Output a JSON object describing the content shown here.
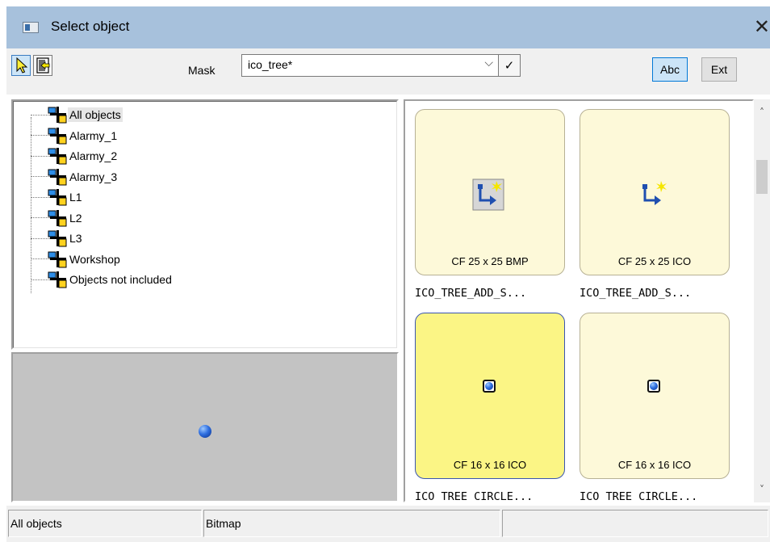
{
  "window": {
    "title": "Select object",
    "close_glyph": "✕"
  },
  "toolbar": {
    "mask_label": "Mask",
    "mask_value": "ico_tree*",
    "dropdown_glyph": "⌵",
    "apply_glyph": "✓",
    "abc_label": "Abc",
    "ext_label": "Ext",
    "pointer_icon": "select-pointer-icon",
    "exit_icon": "exit-icon"
  },
  "tree": {
    "items": [
      {
        "label": "All objects",
        "selected": true
      },
      {
        "label": "Alarmy_1"
      },
      {
        "label": "Alarmy_2"
      },
      {
        "label": "Alarmy_3"
      },
      {
        "label": "L1"
      },
      {
        "label": "L2"
      },
      {
        "label": "L3"
      },
      {
        "label": "Workshop"
      },
      {
        "label": "Objects not included"
      }
    ]
  },
  "gallery": {
    "items": [
      {
        "meta": "CF 25 x  25  BMP",
        "name": "ICO_TREE_ADD_S...",
        "icon": "tree-add-icon"
      },
      {
        "meta": "CF 25 x  25  ICO",
        "name": "ICO_TREE_ADD_S...",
        "icon": "tree-add-icon"
      },
      {
        "meta": "CF 16 x  16  ICO",
        "name": "ICO_TREE_CIRCLE...",
        "icon": "blue-circle-icon",
        "selected": true
      },
      {
        "meta": "CF 16 x  16  ICO",
        "name": "ICO_TREE_CIRCLE...",
        "icon": "blue-circle-icon"
      }
    ]
  },
  "statusbar": {
    "field1": "All objects",
    "field2": "Bitmap",
    "field3": ""
  },
  "colors": {
    "titlebar": "#a7c1dc",
    "card_bg": "#fdf9d9",
    "card_selected": "#fbf585",
    "accent": "#0078d7"
  }
}
